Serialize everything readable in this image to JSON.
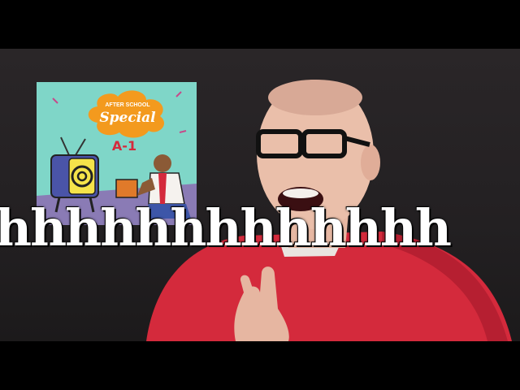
{
  "album_cover": {
    "title_line1": "AFTER SCHOOL",
    "title_line2": "Special",
    "subtitle": "A-1"
  },
  "caption": {
    "text": "hhhhhhhhhhhhh"
  },
  "colors": {
    "background": "#262224",
    "cover_bg": "#7fd6c8",
    "logo_orange": "#f39a1e",
    "sweater_red": "#d42a3c",
    "caption_text": "#ffffff"
  }
}
